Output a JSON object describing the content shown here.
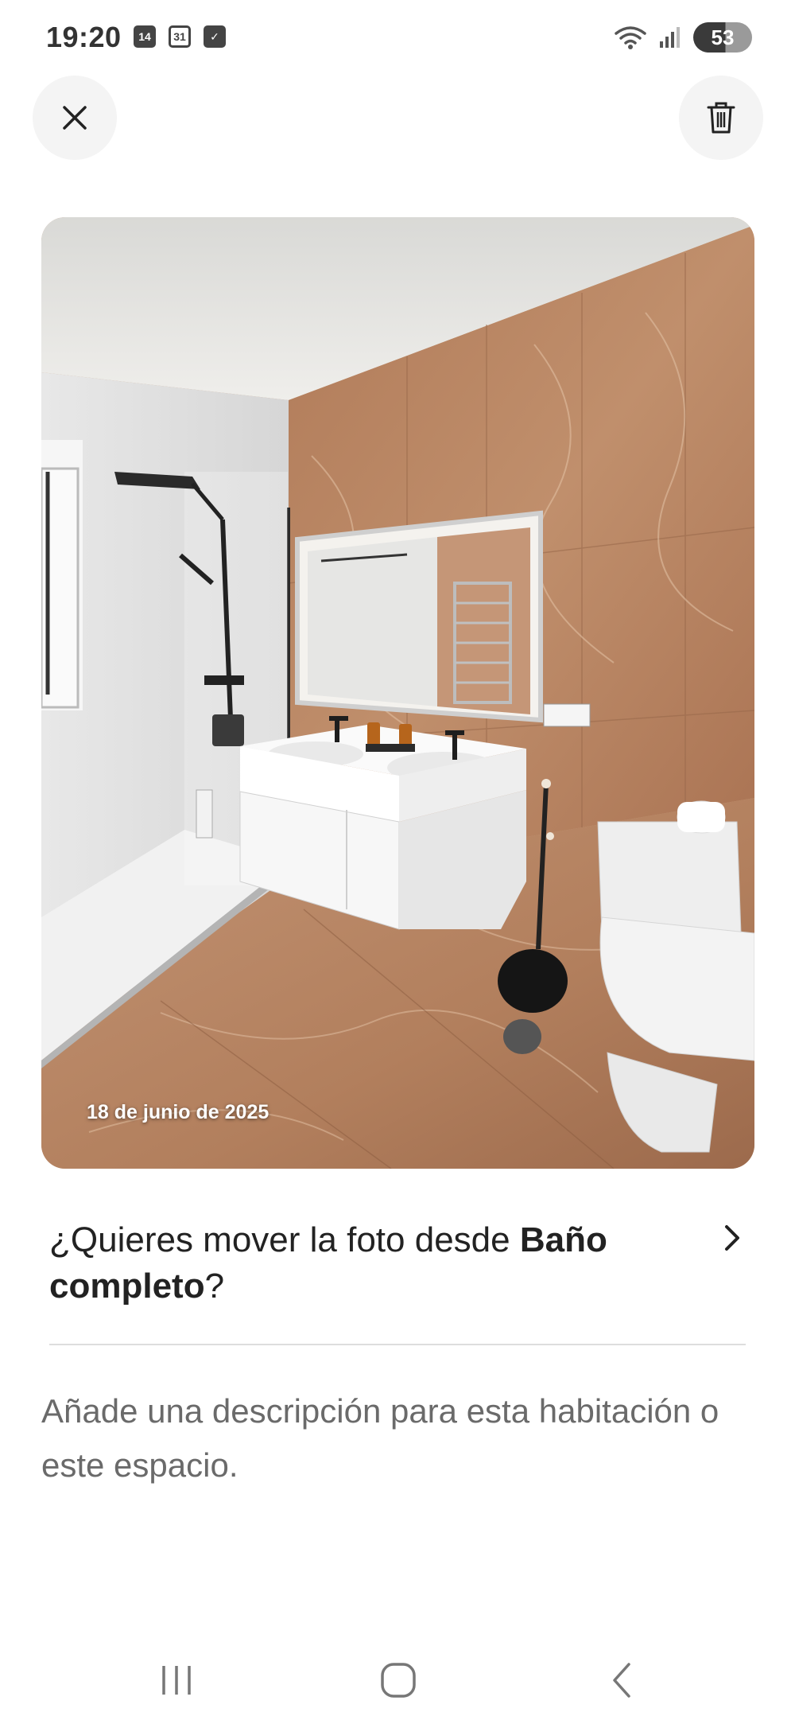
{
  "status_bar": {
    "time": "19:20",
    "notification_icons": [
      "14",
      "31",
      "✓"
    ],
    "battery": "53"
  },
  "top_actions": {
    "close_icon": "close-icon",
    "delete_icon": "trash-icon"
  },
  "photo": {
    "date": "18 de junio de 2025"
  },
  "move_prompt": {
    "prefix": "¿Quieres mover la foto desde ",
    "room_name": "Baño completo",
    "suffix": "?"
  },
  "description": {
    "placeholder": "Añade una descripción para esta habitación o este espacio."
  },
  "nav_bar": {
    "recents_icon": "recents-icon",
    "home_icon": "home-icon",
    "back_icon": "back-icon"
  },
  "colors": {
    "marble": "#b98765",
    "background": "#ffffff",
    "text_primary": "#222222",
    "text_secondary": "#6a6a6a"
  }
}
